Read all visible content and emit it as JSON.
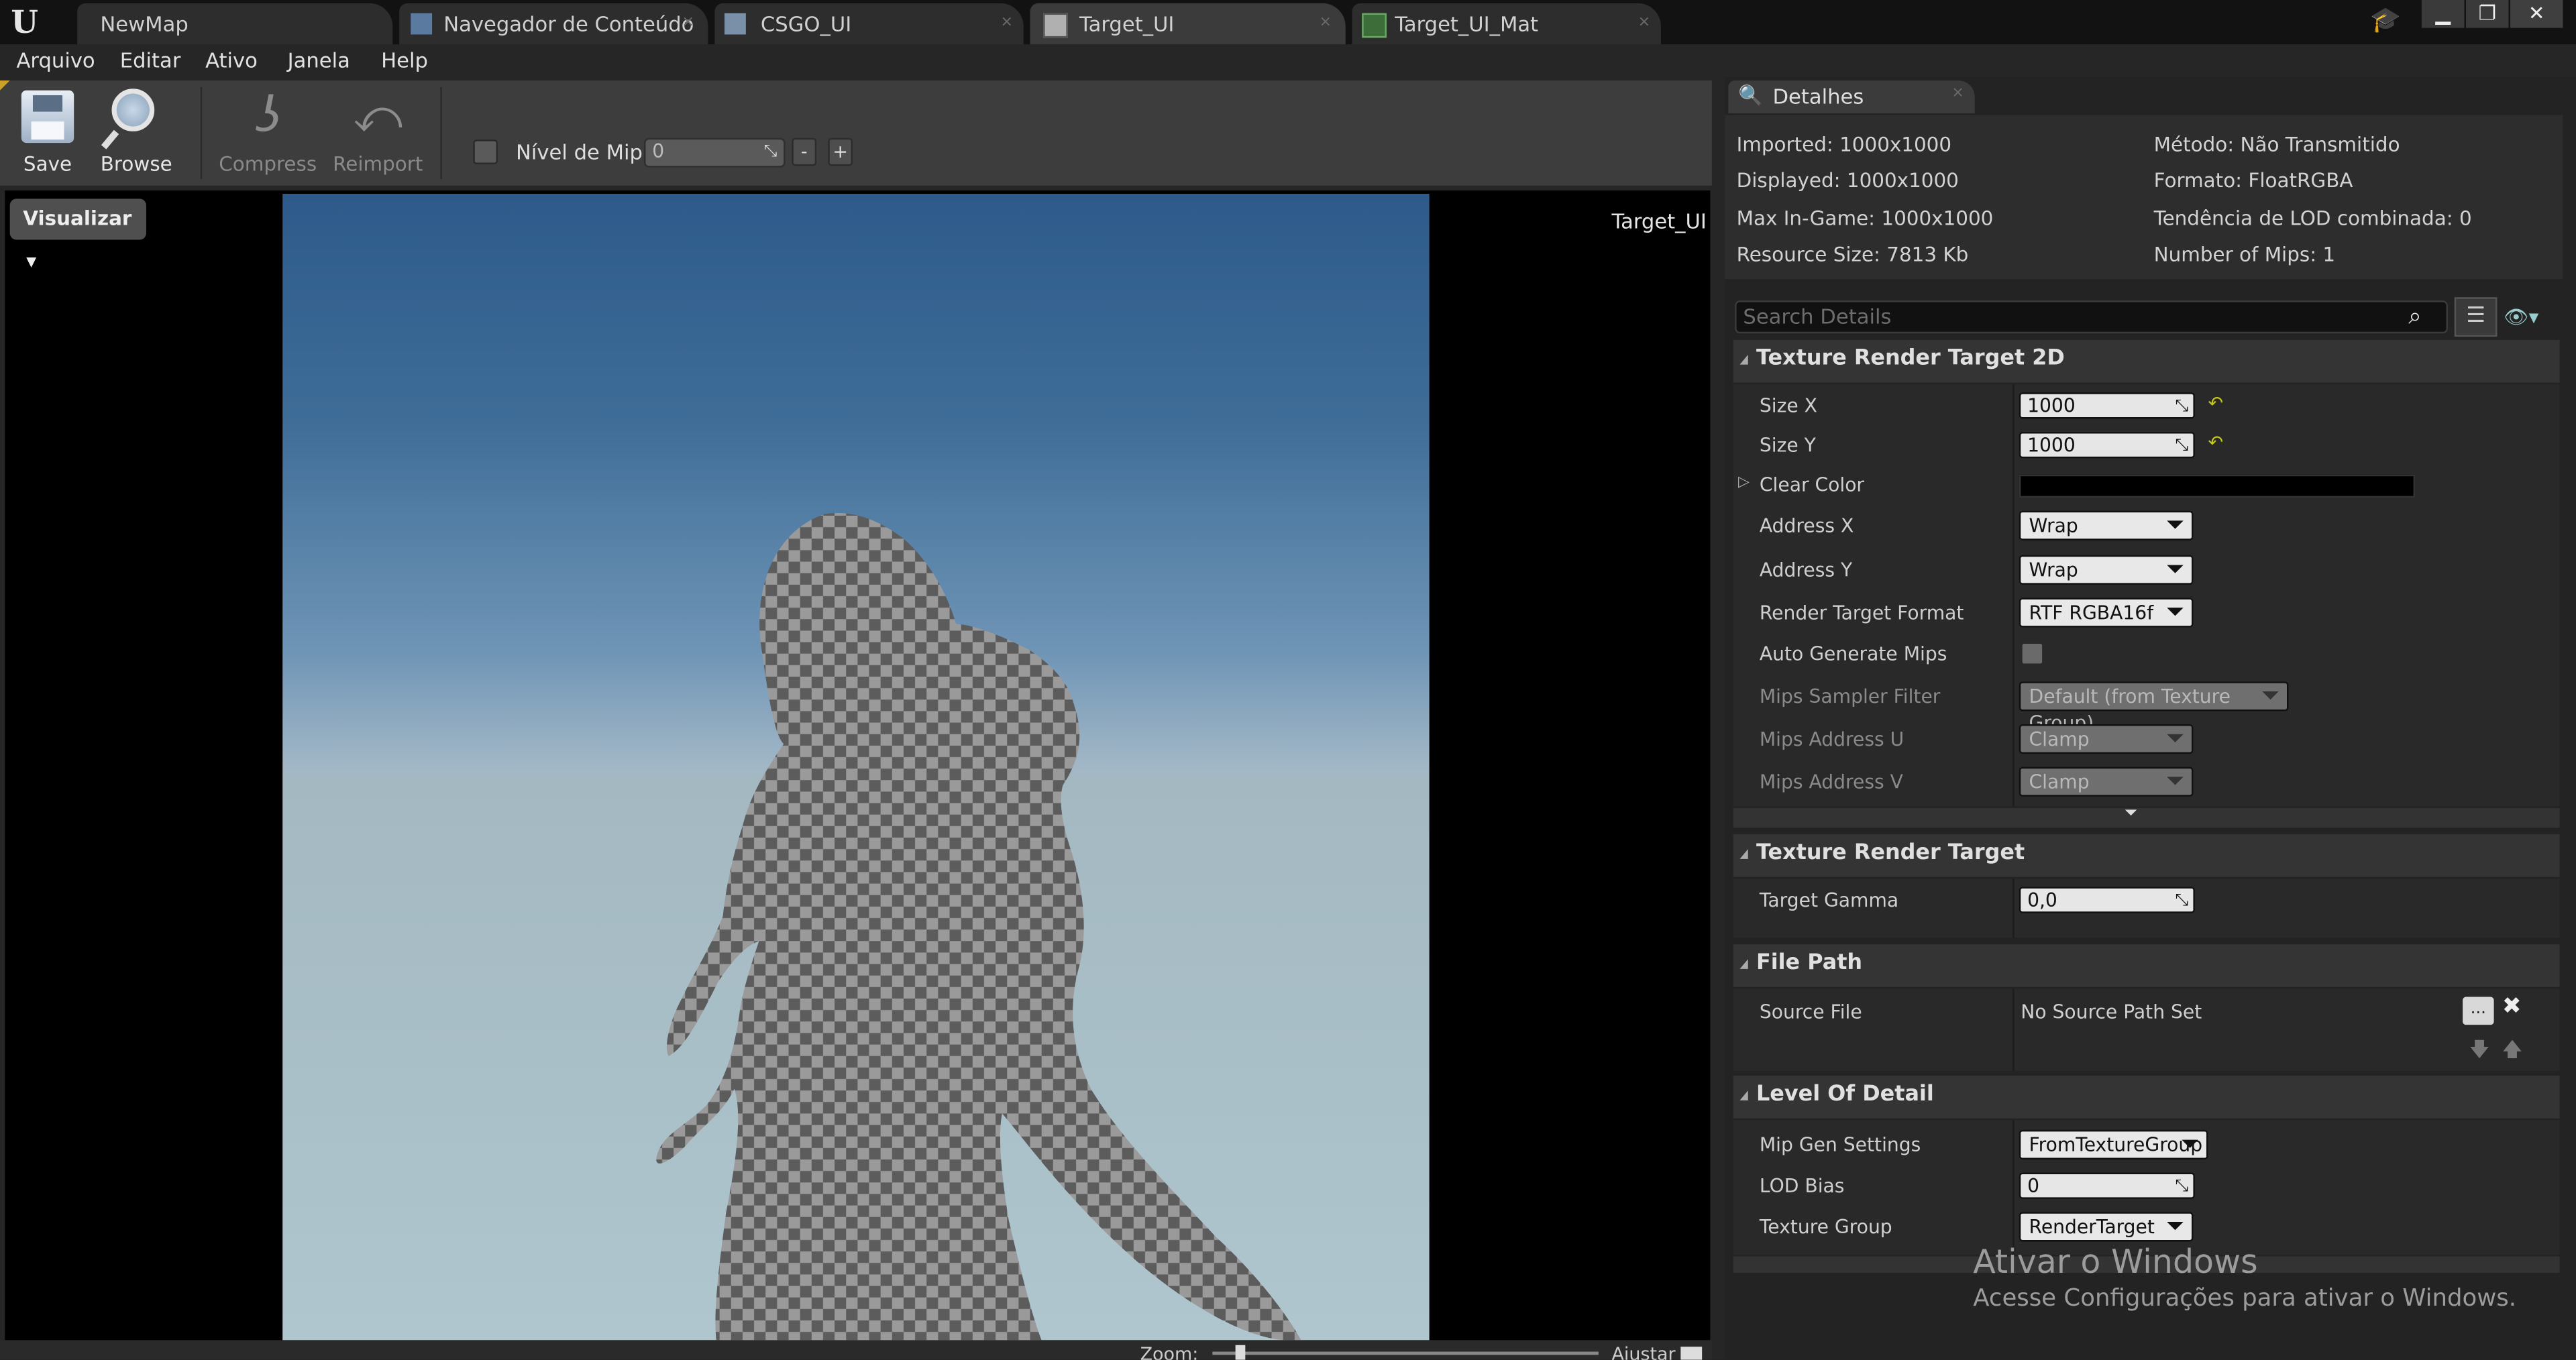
{
  "titlebar": {
    "tabs": [
      {
        "label": "NewMap"
      },
      {
        "label": "Navegador de Conteúdo"
      },
      {
        "label": "CSGO_UI"
      },
      {
        "label": "Target_UI"
      },
      {
        "label": "Target_UI_Mat"
      }
    ],
    "close_glyph": "×"
  },
  "menu": [
    "Arquivo",
    "Editar",
    "Ativo",
    "Janela",
    "Help"
  ],
  "toolbar": {
    "save": "Save",
    "browse": "Browse",
    "compress": "Compress",
    "reimport": "Reimport",
    "mip_label": "Nível de Mip:",
    "mip_value": "0",
    "minus": "-",
    "plus": "+"
  },
  "viewport": {
    "visualizar": "Visualizar",
    "asset_name": "Target_UI",
    "zoom_label": "Zoom:",
    "fit_label": "Ajustar"
  },
  "details": {
    "tab_label": "Detalhes",
    "info_left": [
      "Imported: 1000x1000",
      "Displayed: 1000x1000",
      "Max In-Game: 1000x1000",
      "Resource Size: 7813 Kb"
    ],
    "info_right": [
      "Método: Não Transmitido",
      "Formato: FloatRGBA",
      "Tendência de LOD combinada: 0",
      "Number of Mips: 1"
    ],
    "search_placeholder": "Search Details",
    "sections": {
      "render_target_2d": {
        "title": "Texture Render Target 2D",
        "size_x_label": "Size X",
        "size_x": "1000",
        "size_y_label": "Size Y",
        "size_y": "1000",
        "clear_color_label": "Clear Color",
        "address_x_label": "Address X",
        "address_x": "Wrap",
        "address_y_label": "Address Y",
        "address_y": "Wrap",
        "format_label": "Render Target Format",
        "format": "RTF RGBA16f",
        "auto_mips_label": "Auto Generate Mips",
        "mips_filter_label": "Mips Sampler Filter",
        "mips_filter": "Default (from Texture Group)",
        "mips_u_label": "Mips Address U",
        "mips_u": "Clamp",
        "mips_v_label": "Mips Address V",
        "mips_v": "Clamp"
      },
      "render_target": {
        "title": "Texture Render Target",
        "gamma_label": "Target Gamma",
        "gamma": "0,0"
      },
      "file_path": {
        "title": "File Path",
        "source_label": "Source File",
        "source": "No Source Path Set",
        "browse_btn": "..."
      },
      "lod": {
        "title": "Level Of Detail",
        "mipgen_label": "Mip Gen Settings",
        "mipgen": "FromTextureGroup",
        "lodbias_label": "LOD Bias",
        "lodbias": "0",
        "group_label": "Texture Group",
        "group": "RenderTarget"
      }
    }
  },
  "watermark": {
    "line1": "Ativar o Windows",
    "line2": "Acesse Configurações para ativar o Windows."
  },
  "colors": {
    "clear_color": "#000000",
    "accent_reset": "#c7c71a"
  }
}
